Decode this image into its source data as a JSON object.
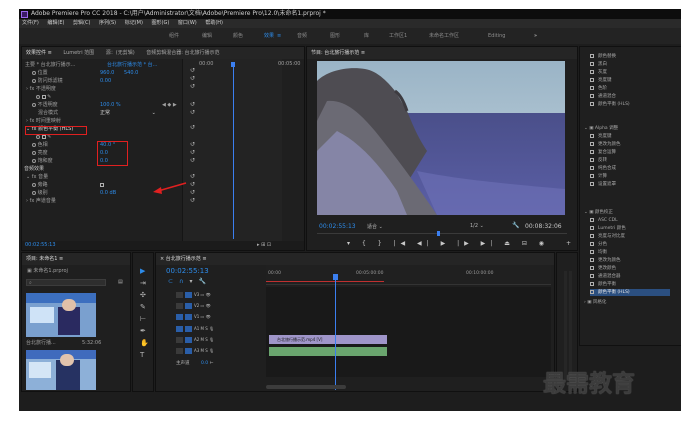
{
  "window": {
    "title": "Adobe Premiere Pro CC 2018 - C:\\用户\\Administrator\\文档\\Adobe\\Premiere Pro\\12.0\\未命名1.prproj *"
  },
  "menu": [
    "文件(F)",
    "编辑(E)",
    "剪辑(C)",
    "序列(S)",
    "标记(M)",
    "图形(G)",
    "窗口(W)",
    "帮助(H)"
  ],
  "workspaces": {
    "items": [
      "组件",
      "编辑",
      "颜色",
      "效果",
      "音频",
      "图形",
      "库",
      "工作区1",
      "未命名工作区",
      "Editing"
    ],
    "active": "效果",
    "more": "»"
  },
  "effect_controls": {
    "tabs": [
      "效果控件 ≡",
      "Lumetri 范围",
      "源：(无剪辑)",
      "音频剪辑混合器: 台北旅行播示范"
    ],
    "master": "主要 * 台北旅行播示...",
    "clip_ref": "台北旅行播示范 * 台...",
    "timecode_start": "00:00",
    "timecode_end": "00:05:00",
    "rows": [
      {
        "label": "位置",
        "v1": "960.0",
        "v2": "540.0"
      },
      {
        "label": "防闪烁滤镜",
        "v1": "0.00"
      },
      {
        "label": "不透明度"
      },
      {
        "label": "不透明度",
        "v1": "100.0 %"
      },
      {
        "label": "混合模式",
        "v1": "正常"
      },
      {
        "label": "时间重映射"
      },
      {
        "label": "颜色平衡 (HLS)"
      },
      {
        "label": "色相",
        "v1": "40.0 °"
      },
      {
        "label": "亮度",
        "v1": "0.0"
      },
      {
        "label": "饱和度",
        "v1": "0.0"
      },
      {
        "label": "音频效果"
      },
      {
        "label": "音量"
      },
      {
        "label": "旁路"
      },
      {
        "label": "级别",
        "v1": "0.0 dB"
      },
      {
        "label": "声道音量"
      }
    ],
    "footer_time": "00:02:55:13"
  },
  "program_monitor": {
    "tab": "节目: 台北旅行播示范 ≡",
    "timecode": "00:02:55:13",
    "fit": "适合",
    "quality": "1/2",
    "duration": "00:08:32:06"
  },
  "effects_panel": {
    "items": [
      "颜色替换",
      "黑白",
      "灰度",
      "亮度键",
      "色阶",
      "通道混合",
      "颜色平衡 (HLS)",
      "Alpha 调整",
      "亮度键",
      "更改为颜色",
      "复合运算",
      "反转",
      "纯色合成",
      "计算",
      "设置遮罩",
      "颜色校正",
      "ASC CDL",
      "Lumetri 颜色",
      "亮度与对比度",
      "分色",
      "均衡",
      "更改为颜色",
      "更改颜色",
      "通道混合器",
      "颜色平衡",
      "颜色平衡 (HLS)",
      "风格化"
    ],
    "highlight": "颜色平衡 (HLS)"
  },
  "project": {
    "tab": "项目: 未命名1 ≡",
    "name": "未命名1.prproj",
    "thumb1_label": "台北旅行播...",
    "thumb1_dur": "5:32:06"
  },
  "timeline": {
    "tab": "× 台北旅行播示范 ≡",
    "timecode": "00:02:55:13",
    "ruler": [
      "00:00",
      "00:05:00:00",
      "00:10:00:00"
    ],
    "tracks": [
      "V3",
      "V2",
      "V1",
      "A1",
      "A2",
      "A3"
    ],
    "master": "主声道",
    "master_val": "0.0",
    "clip_video": "台北旅行播示范.mp4 [V]",
    "clip_audio": ""
  },
  "watermark": "最需教育",
  "colors": {
    "accent": "#2d8ceb",
    "red_box": "#e02020",
    "playhead": "#3b7ff0"
  }
}
